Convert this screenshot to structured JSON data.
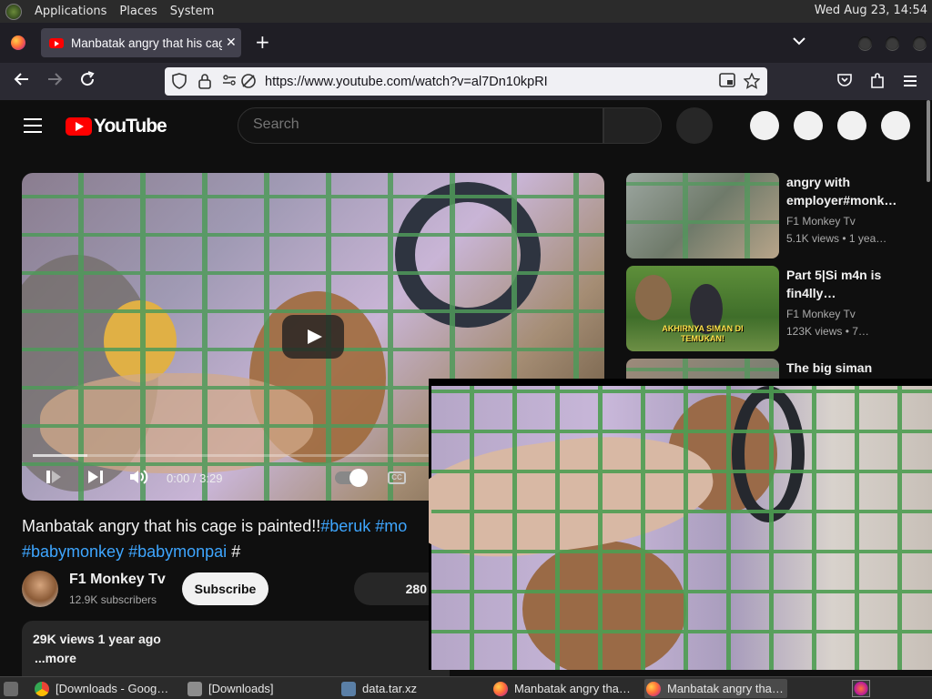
{
  "top_panel": {
    "menus": [
      "Applications",
      "Places",
      "System"
    ],
    "clock": "Wed Aug 23, 14:54"
  },
  "browser": {
    "tab_title": "Manbatak angry that his cage",
    "tab_close": "✕",
    "new_tab": "+",
    "url": "https://www.youtube.com/watch?v=al7Dn10kpRI"
  },
  "youtube": {
    "logo_text": "YouTube",
    "search_placeholder": "Search",
    "player": {
      "time": "0:00 / 3:29",
      "cc": "CC"
    },
    "video": {
      "title_main": "Manbatak angry that his cage is painted!!",
      "title_tag1": "#beruk",
      "title_tag2": "#mo",
      "title_tag3": "#babymonkey",
      "title_tag4": "#babymonpai",
      "title_tail": "#"
    },
    "channel": {
      "name": "F1 Monkey Tv",
      "subscribers": "12.9K subscribers",
      "subscribe_label": "Subscribe"
    },
    "likes": "280",
    "description": {
      "meta": "29K views  1 year ago",
      "more": "...more"
    },
    "sidebar": [
      {
        "title_line1": "angry with",
        "title_line2": "employer#monk…",
        "channel": "F1 Monkey Tv",
        "stats": "5.1K views  • 1 yea…"
      },
      {
        "title_line1": "Part 5|Si m4n is",
        "title_line2": "fin4lly…",
        "channel": "F1 Monkey Tv",
        "stats": "123K views  • 7…",
        "thumb_caption": "AKHIRNYA SIMAN DI TEMUKAN!"
      },
      {
        "title_line1": "The big siman"
      }
    ]
  },
  "taskbar": {
    "items": [
      {
        "label": "[Downloads - Goog…"
      },
      {
        "label": "[Downloads]"
      },
      {
        "label": "data.tar.xz"
      },
      {
        "label": "Manbatak angry tha…"
      },
      {
        "label": "Manbatak angry tha…"
      }
    ]
  },
  "colors": {
    "yt_red": "#ff0000",
    "link_blue": "#3ea6ff",
    "page_bg": "#0f0f0f"
  }
}
